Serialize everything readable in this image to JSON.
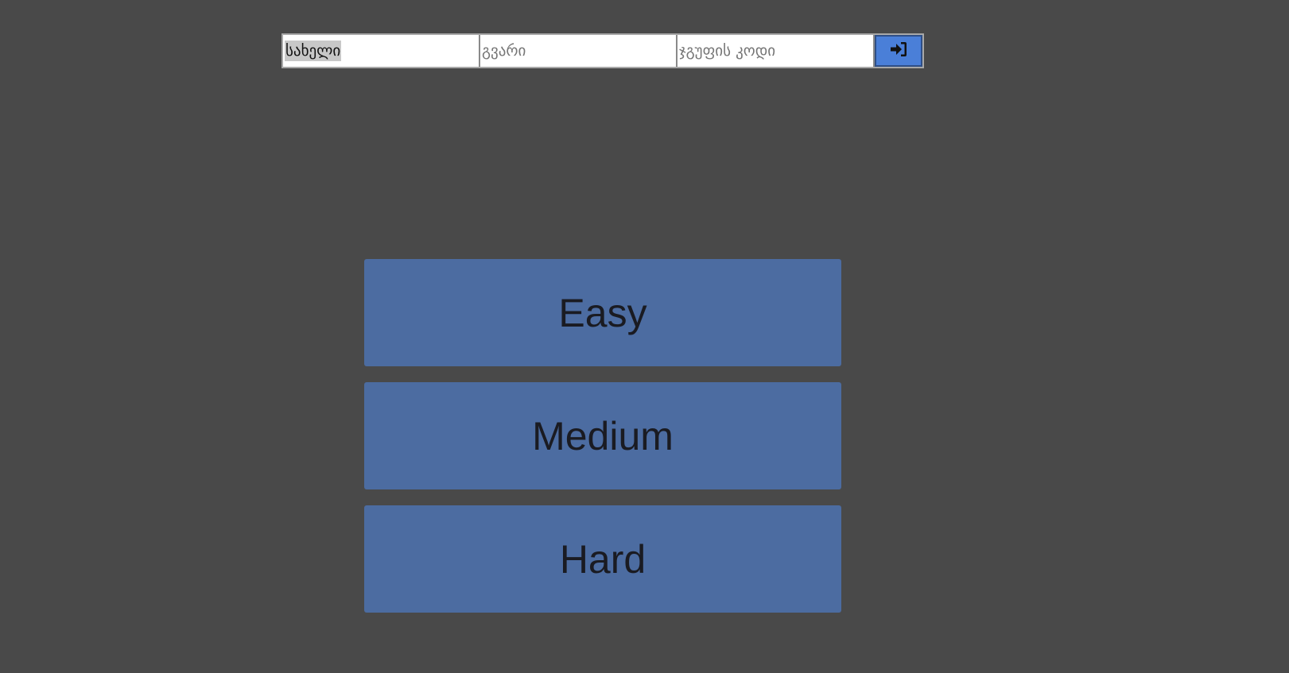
{
  "login_form": {
    "first_name_value": "სახელი",
    "last_name_placeholder": "გვარი",
    "group_code_placeholder": "ჯგუფის კოდი",
    "submit_icon": "sign-in-icon"
  },
  "difficulty": {
    "options": [
      {
        "label": "Easy"
      },
      {
        "label": "Medium"
      },
      {
        "label": "Hard"
      }
    ]
  },
  "colors": {
    "background": "#494949",
    "accent_button": "#4a7fd8",
    "difficulty_button": "#4c6ca1"
  }
}
